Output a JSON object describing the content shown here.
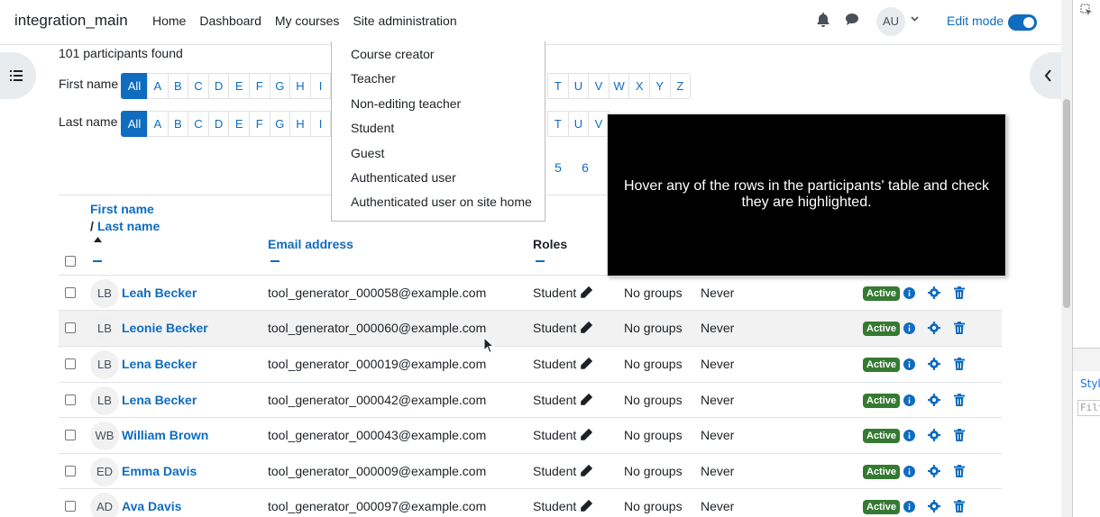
{
  "navbar": {
    "brand": "integration_main",
    "links": [
      "Home",
      "Dashboard",
      "My courses",
      "Site administration"
    ],
    "user_initials": "AU",
    "edit_mode_label": "Edit mode"
  },
  "participants_found": "101 participants found",
  "filters": {
    "first_name_label": "First name",
    "last_name_label": "Last name",
    "first_letters": [
      "All",
      "A",
      "B",
      "C",
      "D",
      "E",
      "F",
      "G",
      "H",
      "I"
    ],
    "first_letters_tail": [
      "T",
      "U",
      "V",
      "W",
      "X",
      "Y",
      "Z"
    ],
    "last_letters": [
      "All",
      "A",
      "B",
      "C",
      "D",
      "E",
      "F",
      "G",
      "H",
      "I"
    ],
    "last_letters_tail": [
      "T",
      "U",
      "V"
    ]
  },
  "pagination": [
    "5",
    "6"
  ],
  "role_dropdown": [
    "Course creator",
    "Teacher",
    "Non-editing teacher",
    "Student",
    "Guest",
    "Authenticated user",
    "Authenticated user on site home"
  ],
  "tooltip": "Hover any of the rows in the participants' table and check they are highlighted.",
  "table": {
    "headers": {
      "first_name": "First name",
      "last_name": "Last name",
      "email": "Email address",
      "roles": "Roles"
    },
    "rows": [
      {
        "initials": "LB",
        "name": "Leah Becker",
        "email": "tool_generator_000058@example.com",
        "role": "Student",
        "groups": "No groups",
        "last_access": "Never",
        "status": "Active"
      },
      {
        "initials": "LB",
        "name": "Leonie Becker",
        "email": "tool_generator_000060@example.com",
        "role": "Student",
        "groups": "No groups",
        "last_access": "Never",
        "status": "Active"
      },
      {
        "initials": "LB",
        "name": "Lena Becker",
        "email": "tool_generator_000019@example.com",
        "role": "Student",
        "groups": "No groups",
        "last_access": "Never",
        "status": "Active"
      },
      {
        "initials": "LB",
        "name": "Lena Becker",
        "email": "tool_generator_000042@example.com",
        "role": "Student",
        "groups": "No groups",
        "last_access": "Never",
        "status": "Active"
      },
      {
        "initials": "WB",
        "name": "William Brown",
        "email": "tool_generator_000043@example.com",
        "role": "Student",
        "groups": "No groups",
        "last_access": "Never",
        "status": "Active"
      },
      {
        "initials": "ED",
        "name": "Emma Davis",
        "email": "tool_generator_000009@example.com",
        "role": "Student",
        "groups": "No groups",
        "last_access": "Never",
        "status": "Active"
      },
      {
        "initials": "AD",
        "name": "Ava Davis",
        "email": "tool_generator_000097@example.com",
        "role": "Student",
        "groups": "No groups",
        "last_access": "Never",
        "status": "Active"
      }
    ]
  },
  "devtools": {
    "styles_tab": "Styl",
    "filter_placeholder": "Filt"
  },
  "colors": {
    "link": "#0f6cbf",
    "badge_active": "#357a32",
    "tooltip_bg": "#000000"
  }
}
